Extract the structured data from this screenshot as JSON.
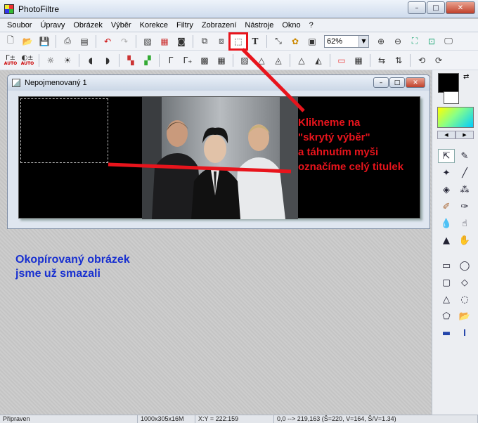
{
  "app": {
    "title": "PhotoFiltre"
  },
  "window_buttons": {
    "minimize": "–",
    "maximize": "□",
    "close": "✕"
  },
  "menu": [
    "Soubor",
    "Úpravy",
    "Obrázek",
    "Výběr",
    "Korekce",
    "Filtry",
    "Zobrazení",
    "Nástroje",
    "Okno",
    "?"
  ],
  "toolbar": {
    "zoom_value": "62%",
    "text_tool": "T",
    "auto_label": "AUTO"
  },
  "document": {
    "title": "Nepojmenovaný 1",
    "buttons": {
      "minimize": "–",
      "maximize": "□",
      "close": "✕"
    }
  },
  "annotations": {
    "red_lines": [
      "Klikneme na",
      "\"skrytý výběr\"",
      "a táhnutím myši",
      "označíme celý titulek"
    ],
    "blue_lines": [
      "Okopírovaný obrázek",
      "jsme už smazali"
    ],
    "accent_red": "#e8141c",
    "accent_blue": "#1830d0"
  },
  "palette": {
    "foreground": "#000000",
    "background": "#ffffff"
  },
  "status": {
    "state": "Připraven",
    "image_info": "1000x305x16M",
    "cursor": "X:Y = 222:159",
    "selection": "0,0 --> 219,163 (Š=220, V=164, Š/V=1.34)"
  }
}
